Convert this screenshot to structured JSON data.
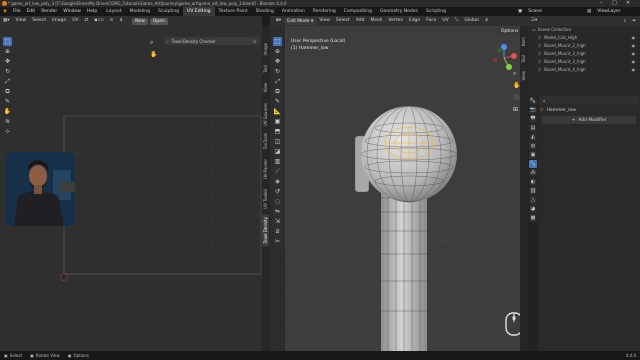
{
  "titlebar": {
    "title": "* game_art_low_poly_3 [F:\\Google\\Drive\\My Drive\\CGMG_Tutorials\\Game_Art\\Journey\\game_art\\game_art_low_poly_3.blend] - Blender 4.4.0"
  },
  "menu": [
    "File",
    "Edit",
    "Render",
    "Window",
    "Help"
  ],
  "workspaces": [
    {
      "label": "Layout"
    },
    {
      "label": "Modeling"
    },
    {
      "label": "Sculpting"
    },
    {
      "label": "UV Editing",
      "active": true
    },
    {
      "label": "Texture Paint"
    },
    {
      "label": "Shading"
    },
    {
      "label": "Animation"
    },
    {
      "label": "Rendering"
    },
    {
      "label": "Compositing"
    },
    {
      "label": "Geometry Nodes"
    },
    {
      "label": "Scripting"
    }
  ],
  "scene": {
    "label": "Scene",
    "viewlayer": "ViewLayer"
  },
  "uv": {
    "menu": [
      "View",
      "Select",
      "Image",
      "UV"
    ],
    "new_label": "New",
    "open_label": "Open",
    "panel_label": "Texel Density Checker",
    "side_tabs": [
      "Image",
      "Tool",
      "View",
      "UV Squares",
      "TexTools",
      "UV-Packer",
      "UV Toolkit",
      "Texel Density"
    ]
  },
  "viewport": {
    "mode": "Edit Mode",
    "menu": [
      "View",
      "Select",
      "Add",
      "Mesh",
      "Vertex",
      "Edge",
      "Face",
      "UV"
    ],
    "orientation": "Global",
    "options_label": "Options",
    "overlay_title": "User Perspective (Local)",
    "overlay_object": "(1) Hammer_low",
    "side_tabs": [
      "Item",
      "Tool",
      "View"
    ],
    "gizmo": {
      "x_color": "#e24f4f",
      "y_color": "#8bcc3c",
      "z_color": "#4e8ff0"
    }
  },
  "outliner": {
    "collection": "Scene Collection",
    "items": [
      "Model_Cub_High",
      "Board_Mount_2_high",
      "Board_Mount_3_high",
      "Board_Mount_3_high",
      "Board_Mount_4_high"
    ]
  },
  "properties": {
    "object_name": "Hammer_low",
    "add_modifier": "Add Modifier"
  },
  "status": {
    "select": "Select",
    "rotate": "Rotate View",
    "options": "Options",
    "version": "4.4.0"
  },
  "colors": {
    "accent": "#4772b3",
    "brand": "#e87d0d",
    "selected_edge": "#f0b429"
  }
}
